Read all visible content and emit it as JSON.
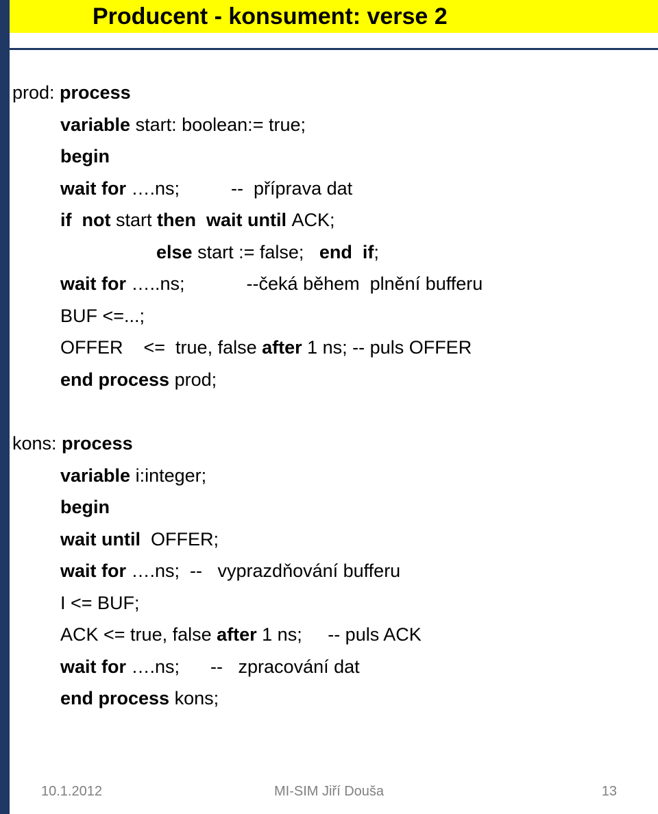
{
  "slide": {
    "title": "Producent - konsument: verse 2",
    "accent_color": "#1f3864",
    "banner_color": "#ffff00"
  },
  "code": [
    {
      "indent": 0,
      "segments": [
        {
          "t": "prod: ",
          "b": false
        },
        {
          "t": "process",
          "b": true
        }
      ]
    },
    {
      "indent": 1,
      "segments": [
        {
          "t": "variable ",
          "b": true
        },
        {
          "t": "start: boolean:= true;",
          "b": false
        }
      ]
    },
    {
      "indent": 1,
      "segments": [
        {
          "t": "begin",
          "b": true
        }
      ]
    },
    {
      "indent": 1,
      "segments": [
        {
          "t": "wait for ",
          "b": true
        },
        {
          "t": "….ns;          --  příprava dat",
          "b": false
        }
      ]
    },
    {
      "indent": 1,
      "segments": [
        {
          "t": "if  not ",
          "b": true
        },
        {
          "t": "start ",
          "b": false
        },
        {
          "t": "then  wait until ",
          "b": true
        },
        {
          "t": "ACK;",
          "b": false
        }
      ]
    },
    {
      "indent": 2,
      "segments": [
        {
          "t": "else ",
          "b": true
        },
        {
          "t": "start := false;   ",
          "b": false
        },
        {
          "t": "end  if",
          "b": true
        },
        {
          "t": ";",
          "b": false
        }
      ]
    },
    {
      "indent": 1,
      "segments": [
        {
          "t": "wait for ",
          "b": true
        },
        {
          "t": "…..ns;            --čeká během  plnění bufferu",
          "b": false
        }
      ]
    },
    {
      "indent": 1,
      "segments": [
        {
          "t": "BUF <=...;",
          "b": false
        }
      ]
    },
    {
      "indent": 1,
      "segments": [
        {
          "t": "OFFER    <=  true, false ",
          "b": false
        },
        {
          "t": "after ",
          "b": true
        },
        {
          "t": "1 ns; -- puls OFFER",
          "b": false
        }
      ]
    },
    {
      "indent": 1,
      "segments": [
        {
          "t": "end process ",
          "b": true
        },
        {
          "t": "prod;",
          "b": false
        }
      ]
    },
    {
      "indent": 0,
      "gap": true,
      "segments": []
    },
    {
      "indent": 0,
      "segments": [
        {
          "t": "kons: ",
          "b": false
        },
        {
          "t": "process",
          "b": true
        }
      ]
    },
    {
      "indent": 1,
      "segments": [
        {
          "t": "variable ",
          "b": true
        },
        {
          "t": "i:integer;",
          "b": false
        }
      ]
    },
    {
      "indent": 1,
      "segments": [
        {
          "t": "begin",
          "b": true
        }
      ]
    },
    {
      "indent": 1,
      "segments": [
        {
          "t": "wait until ",
          "b": true
        },
        {
          "t": " OFFER;",
          "b": false
        }
      ]
    },
    {
      "indent": 1,
      "segments": [
        {
          "t": "wait for ",
          "b": true
        },
        {
          "t": "….ns;  --   vyprazdňování bufferu",
          "b": false
        }
      ]
    },
    {
      "indent": 1,
      "segments": [
        {
          "t": "I <= BUF;",
          "b": false
        }
      ]
    },
    {
      "indent": 1,
      "segments": [
        {
          "t": "ACK <= true, false ",
          "b": false
        },
        {
          "t": "after ",
          "b": true
        },
        {
          "t": "1 ns;     -- puls ACK",
          "b": false
        }
      ]
    },
    {
      "indent": 1,
      "segments": [
        {
          "t": "wait for ",
          "b": true
        },
        {
          "t": "….ns;      --   zpracování dat",
          "b": false
        }
      ]
    },
    {
      "indent": 1,
      "segments": [
        {
          "t": "end process ",
          "b": true
        },
        {
          "t": "kons;",
          "b": false
        }
      ]
    }
  ],
  "footer": {
    "date": "10.1.2012",
    "center": "MI-SIM   Jiří Douša",
    "page": "13"
  }
}
